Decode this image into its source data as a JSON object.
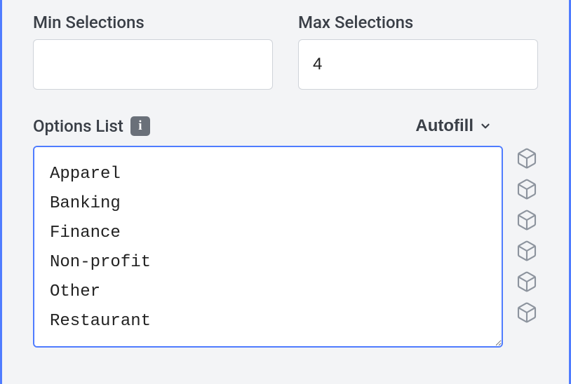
{
  "fields": {
    "min_selections": {
      "label": "Min Selections",
      "value": ""
    },
    "max_selections": {
      "label": "Max Selections",
      "value": "4"
    }
  },
  "options_list": {
    "label": "Options List",
    "autofill_label": "Autofill",
    "items": [
      "Apparel",
      "Banking",
      "Finance",
      "Non-profit",
      "Other",
      "Restaurant"
    ]
  }
}
